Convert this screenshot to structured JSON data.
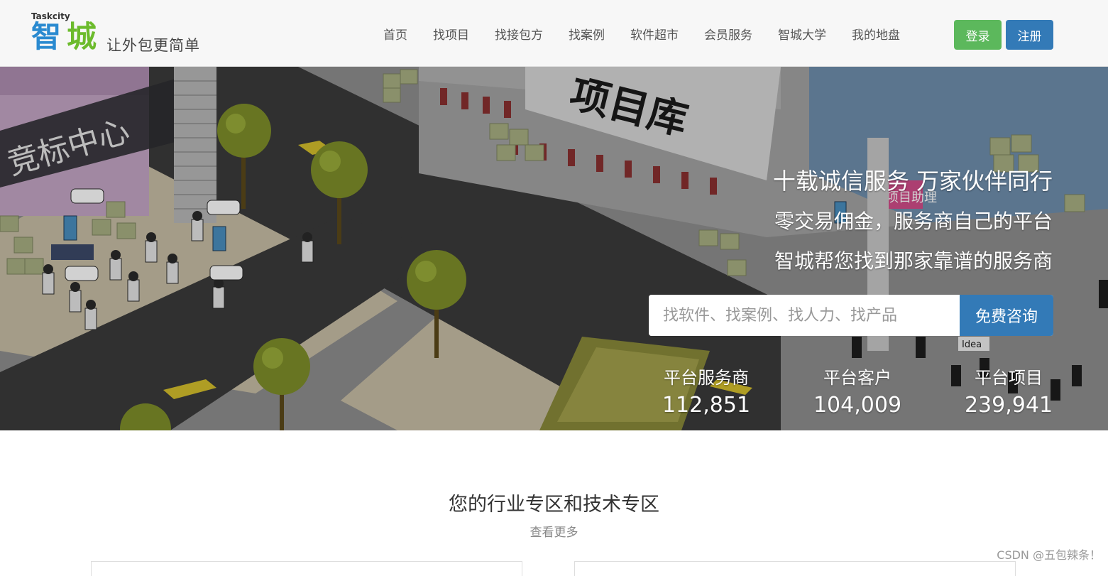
{
  "header": {
    "logo": {
      "small_text": "Taskcity",
      "char1": "智",
      "char2": "城",
      "slogan": "让外包更简单"
    },
    "nav": [
      "首页",
      "找项目",
      "找接包方",
      "找案例",
      "软件超市",
      "会员服务",
      "智城大学",
      "我的地盘"
    ],
    "login_label": "登录",
    "register_label": "注册"
  },
  "hero": {
    "scene_labels": {
      "sign_left": "竞标中心",
      "sign_mid": "项目库",
      "sign_right": "项目助理",
      "idea_tag": "Idea"
    },
    "taglines": [
      "十载诚信服务 万家伙伴同行",
      "零交易佣金，服务商自己的平台",
      "智城帮您找到那家靠谱的服务商"
    ],
    "search": {
      "placeholder": "找软件、找案例、找人力、找产品",
      "button_label": "免费咨询"
    },
    "stats": [
      {
        "label": "平台服务商",
        "value": "112,851"
      },
      {
        "label": "平台客户",
        "value": "104,009"
      },
      {
        "label": "平台项目",
        "value": "239,941"
      }
    ]
  },
  "content": {
    "section_title": "您的行业专区和技术专区",
    "more_link": "查看更多"
  },
  "watermark": "CSDN @五包辣条！",
  "colors": {
    "brand_blue": "#337ab7",
    "brand_green": "#5cb85c",
    "logo_blue": "#2a8ad0",
    "logo_green": "#6cbb2c"
  }
}
